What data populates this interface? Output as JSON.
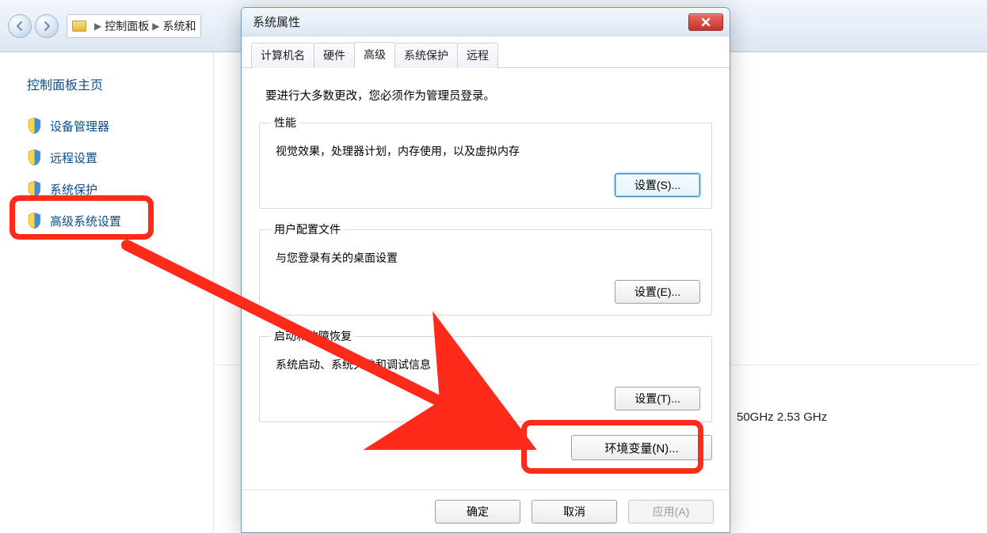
{
  "breadcrumb": {
    "item1": "控制面板",
    "item2": "系统和"
  },
  "sidebar": {
    "title": "控制面板主页",
    "items": [
      {
        "label": "设备管理器"
      },
      {
        "label": "远程设置"
      },
      {
        "label": "系统保护"
      },
      {
        "label": "高级系统设置"
      }
    ]
  },
  "sysinfo": {
    "cpu_fragment": "50GHz  2.53 GHz"
  },
  "dialog": {
    "title": "系统属性",
    "tabs": [
      {
        "label": "计算机名"
      },
      {
        "label": "硬件"
      },
      {
        "label": "高级"
      },
      {
        "label": "系统保护"
      },
      {
        "label": "远程"
      }
    ],
    "active_tab": 2,
    "admin_note": "要进行大多数更改，您必须作为管理员登录。",
    "performance": {
      "legend": "性能",
      "desc": "视觉效果，处理器计划，内存使用，以及虚拟内存",
      "button": "设置(S)..."
    },
    "profiles": {
      "legend": "用户配置文件",
      "desc": "与您登录有关的桌面设置",
      "button": "设置(E)..."
    },
    "startup": {
      "legend": "启动和故障恢复",
      "desc": "系统启动、系统失败和调试信息",
      "button": "设置(T)..."
    },
    "env_button": "环境变量(N)...",
    "ok": "确定",
    "cancel": "取消",
    "apply": "应用(A)"
  }
}
